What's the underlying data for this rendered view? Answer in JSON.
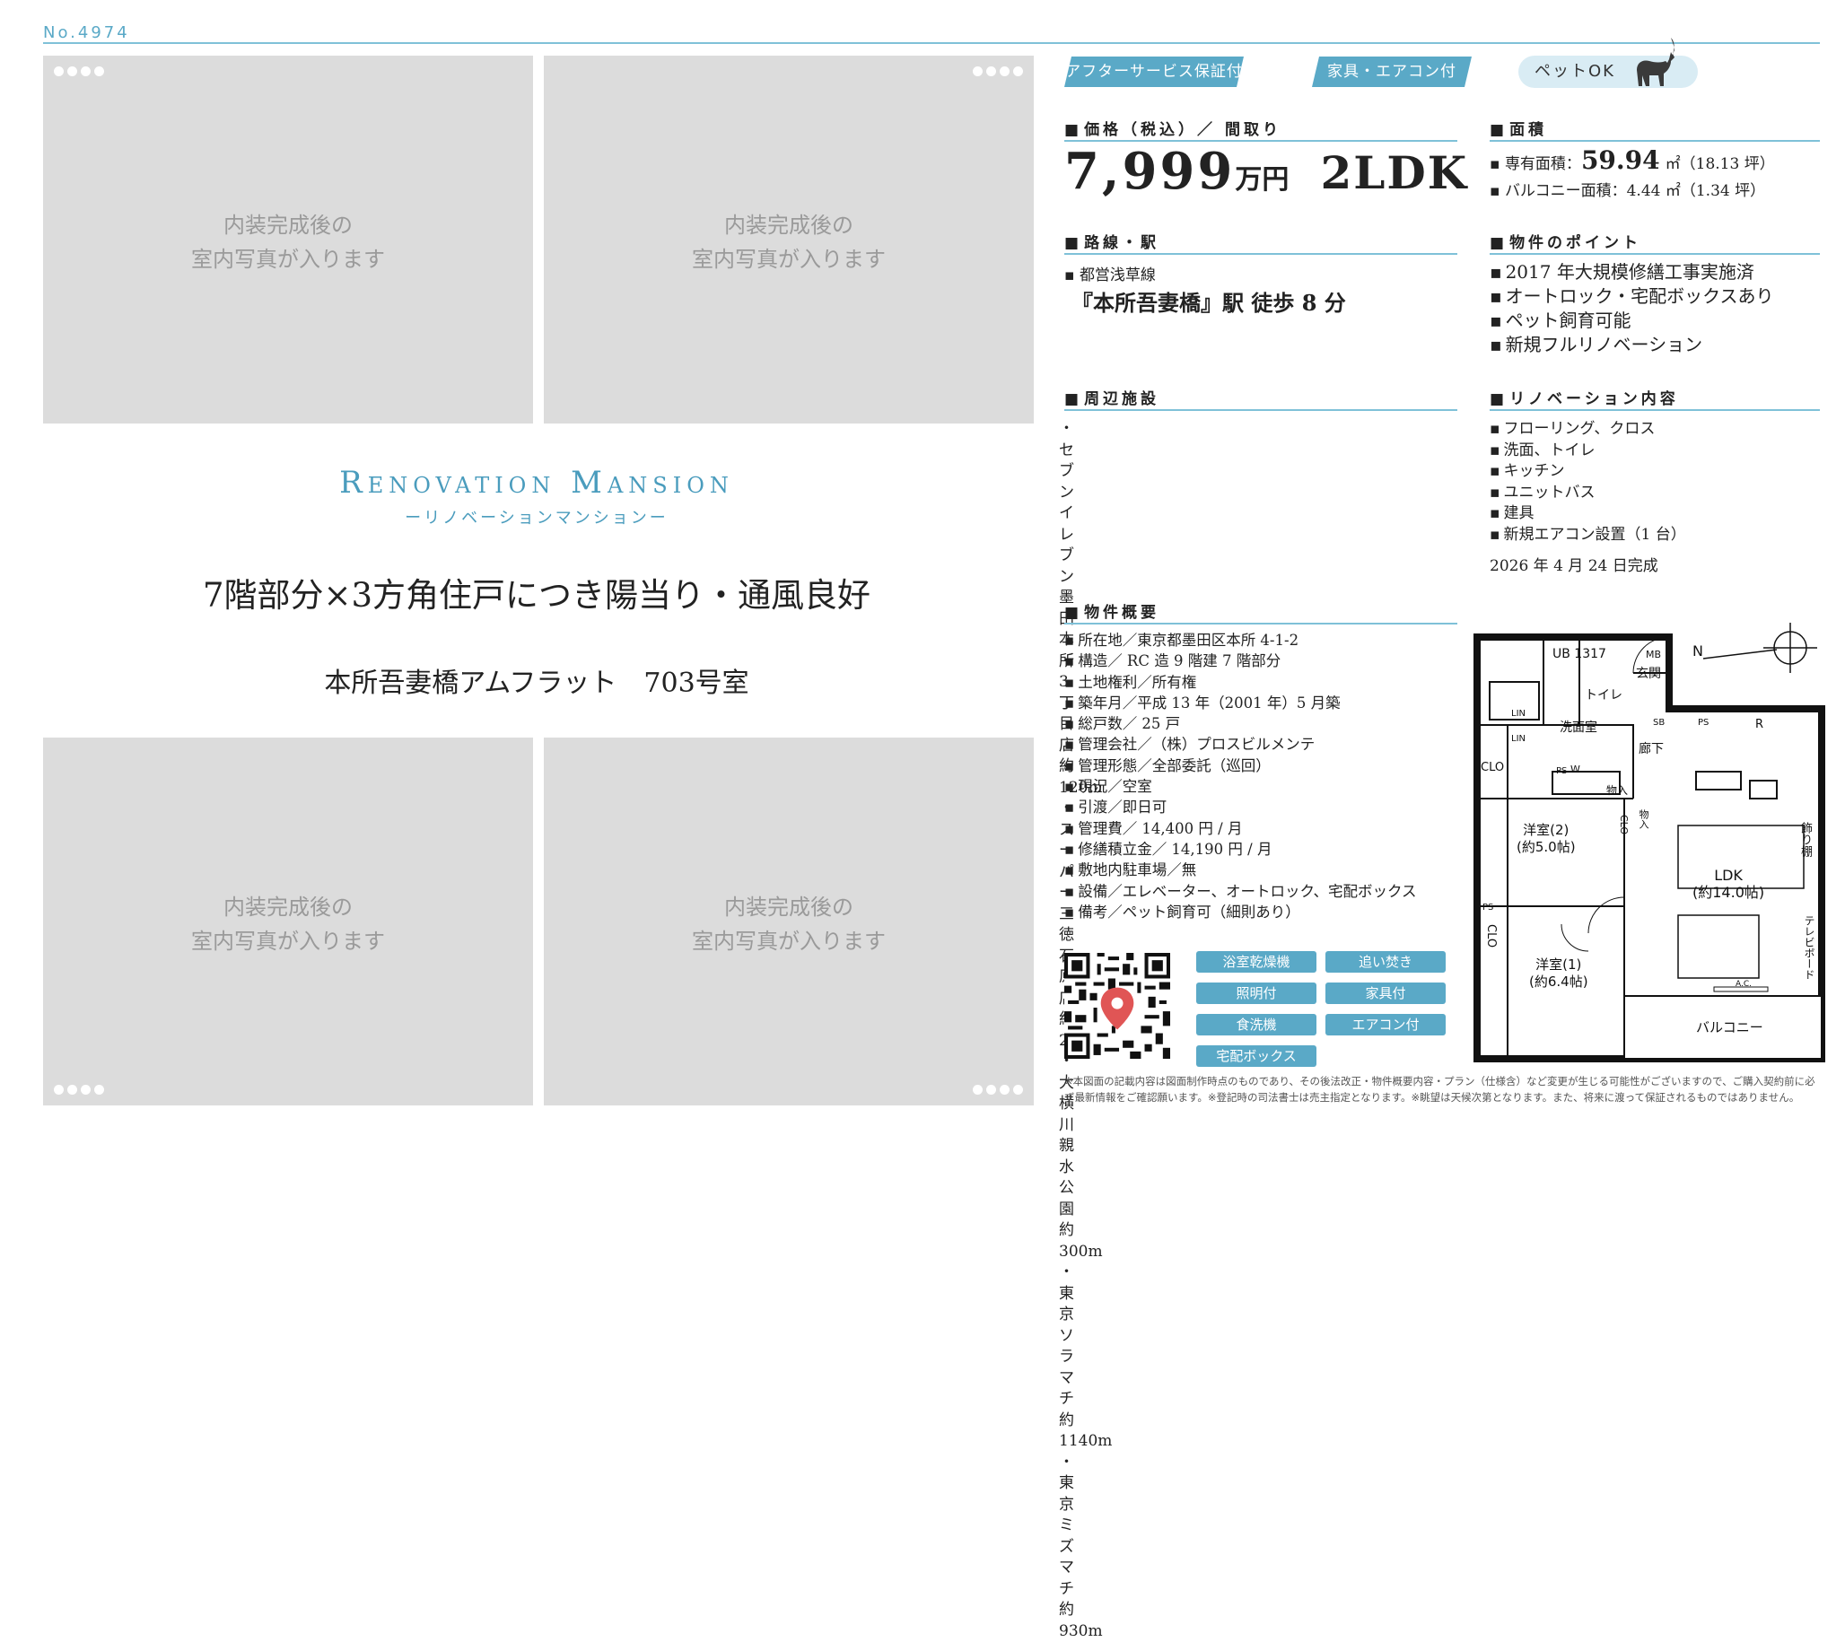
{
  "header": {
    "doc_no": "No.4974"
  },
  "photos": {
    "placeholder_line1": "内装完成後の",
    "placeholder_line2": "室内写真が入ります"
  },
  "title": {
    "brand": "Renovation Mansion",
    "brand_sub": "ーリノベーションマンションー",
    "catchphrase": "7階部分×3方角住戸につき陽当り・通風良好",
    "property_name": "本所吾妻橋アムフラット　703号室"
  },
  "tags": [
    "アフターサービス保証付",
    "家具・エアコン付"
  ],
  "pet_badge": "ペットOK",
  "price_section": {
    "heading": "価格（税込）／ 間取り",
    "price": "7,999",
    "price_unit": "万円",
    "layout": "2LDK"
  },
  "area_section": {
    "heading": "面積",
    "private_label": "専有面積：",
    "private_value": "59.94",
    "private_unit": "㎡（18.13 坪）",
    "balcony": "バルコニー面積：4.44 ㎡（1.34 坪）"
  },
  "route_section": {
    "heading": "路線・駅",
    "line": "都営浅草線",
    "station": "『本所吾妻橋』駅 徒歩 8 分"
  },
  "points_section": {
    "heading": "物件のポイント",
    "items": [
      "2017 年大規模修繕工事実施済",
      "オートロック・宅配ボックスあり",
      "ペット飼育可能",
      "新規フルリノベーション"
    ]
  },
  "facilities_section": {
    "heading": "周辺施設",
    "items": [
      "セブンイレブン墨田本所 3 丁目店　約 120m",
      "スーパー三徳石原店　約 290m",
      "大横川親水公園　約 300m",
      "東京ソラマチ　約 1140m",
      "東京ミズマチ　約 930m"
    ]
  },
  "renovation_section": {
    "heading": "リノベーション内容",
    "items": [
      "フローリング、クロス",
      "洗面、トイレ",
      "キッチン",
      "ユニットバス",
      "建具",
      "新規エアコン設置（1 台）"
    ],
    "completion": "2026 年 4 月 24 日完成"
  },
  "overview_section": {
    "heading": "物件概要",
    "items": [
      "所在地／東京都墨田区本所 4-1-2",
      "構造／ RC 造 9 階建 7 階部分",
      "土地権利／所有権",
      "築年月／平成 13 年（2001 年）5 月築",
      "総戸数／ 25 戸",
      "管理会社／（株）プロスビルメンテ",
      "管理形態／全部委託（巡回）",
      "現況／空室",
      "引渡／即日可",
      "管理費／ 14,400 円 / 月",
      "修繕積立金／ 14,190 円 / 月",
      "敷地内駐車場／無",
      "設備／エレベーター、オートロック、宅配ボックス",
      "備考／ペット飼育可（細則あり）"
    ]
  },
  "equipment": [
    "浴室乾燥機",
    "追い焚き",
    "照明付",
    "家具付",
    "食洗機",
    "エアコン付",
    "宅配ボックス"
  ],
  "floorplan": {
    "rooms": {
      "ub": "UB\n1317",
      "toilet": "トイレ",
      "entrance": "玄関",
      "mb": "MB",
      "washroom": "洗面室",
      "hallway": "廊下",
      "clo1": "CLO",
      "lin1": "LIN",
      "lin2": "LIN",
      "sb": "SB",
      "ps1": "PS",
      "ps2": "PS",
      "ps3": "PS",
      "wlw": "W",
      "storage1": "物入",
      "storage2": "物入",
      "clo2": "CLO",
      "room2": "洋室(2)\n(約5.0帖)",
      "room1": "洋室(1)\n(約6.4帖)",
      "clo3": "CLO",
      "ldk": "LDK\n(約14.0帖)",
      "shelf": "飾り棚",
      "tvboard": "テレビボード",
      "balcony": "バルコニー",
      "refrigerator": "R",
      "ac": "A.C.",
      "north": "N"
    }
  },
  "footnote": "※本図面の記載内容は図面制作時点のものであり、その後法改正・物件概要内容・プラン（仕様含）など変更が生じる可能性がございますので、ご購入契約前に必ず最新情報をご確認願います。※登記時の司法書士は売主指定となります。※眺望は天候次第となります。また、将来に渡って保証されるものではありません。",
  "colors": {
    "accent": "#5aa9c7",
    "photo_bg": "#dcdcdc"
  }
}
